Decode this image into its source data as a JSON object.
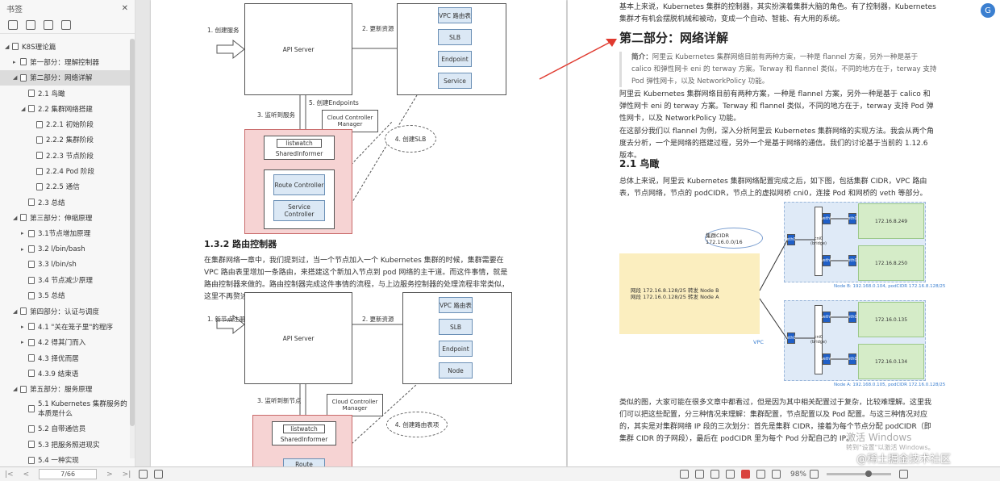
{
  "sidebar": {
    "title": "书签",
    "close": "✕",
    "items": [
      {
        "label": "K8S理论篇",
        "arrow": "◢",
        "indent": 0
      },
      {
        "label": "第一部分：理解控制器",
        "arrow": "▸",
        "indent": 1
      },
      {
        "label": "第二部分：网络详解",
        "arrow": "◢",
        "indent": 1,
        "active": true
      },
      {
        "label": "2.1 鸟瞰",
        "arrow": "",
        "indent": 2
      },
      {
        "label": "2.2 集群网络搭建",
        "arrow": "◢",
        "indent": 2
      },
      {
        "label": "2.2.1 初始阶段",
        "arrow": "",
        "indent": 3
      },
      {
        "label": "2.2.2 集群阶段",
        "arrow": "",
        "indent": 3
      },
      {
        "label": "2.2.3 节点阶段",
        "arrow": "",
        "indent": 3
      },
      {
        "label": "2.2.4 Pod 阶段",
        "arrow": "",
        "indent": 3
      },
      {
        "label": "2.2.5 通信",
        "arrow": "",
        "indent": 3
      },
      {
        "label": "2.3 总结",
        "arrow": "",
        "indent": 2
      },
      {
        "label": "第三部分：伸缩原理",
        "arrow": "◢",
        "indent": 1
      },
      {
        "label": "3.1节点增加原理",
        "arrow": "▸",
        "indent": 2
      },
      {
        "label": "3.2 l/bin/bash",
        "arrow": "▸",
        "indent": 2
      },
      {
        "label": "3.3 l/bin/sh",
        "arrow": "",
        "indent": 2
      },
      {
        "label": "3.4 节点减少原理",
        "arrow": "",
        "indent": 2
      },
      {
        "label": "3.5 总结",
        "arrow": "",
        "indent": 2
      },
      {
        "label": "第四部分：认证与调度",
        "arrow": "◢",
        "indent": 1
      },
      {
        "label": "4.1 \"关在笼子里\"的程序",
        "arrow": "▸",
        "indent": 2
      },
      {
        "label": "4.2 得其门而入",
        "arrow": "▸",
        "indent": 2
      },
      {
        "label": "4.3 择优而居",
        "arrow": "",
        "indent": 2
      },
      {
        "label": "4.3.9 结束语",
        "arrow": "",
        "indent": 2
      },
      {
        "label": "第五部分：服务原理",
        "arrow": "◢",
        "indent": 1
      },
      {
        "label": "5.1 Kubernetes 集群服务的本质是什么",
        "arrow": "",
        "indent": 2,
        "two": true
      },
      {
        "label": "5.2 自带通信员",
        "arrow": "",
        "indent": 2
      },
      {
        "label": "5.3 把服务照进现实",
        "arrow": "",
        "indent": 2
      },
      {
        "label": "5.4 一种实现",
        "arrow": "",
        "indent": 2
      }
    ]
  },
  "diagram1": {
    "create": "1. 创建服务",
    "api": "API Server",
    "update": "2. 更新资源",
    "vpc": "VPC 路由表",
    "slb": "SLB",
    "endpoint": "Endpoint",
    "service": "Service",
    "listen": "3. 监听到服务",
    "createEp": "5. 创建Endpoints",
    "ccm": "Cloud Controller Manager",
    "listwatch": "listwatch",
    "informer": "SharedInformer",
    "route": "Route Controller",
    "svc": "Service Controller",
    "createSlb": "4. 创建SLB"
  },
  "section132": {
    "title": "1.3.2 路由控制器",
    "body": "在集群网络一章中，我们提到过，当一个节点加入一个 Kubernetes 集群的时候，集群需要在 VPC 路由表里增加一条路由，来搭建这个新加入节点到 pod 网络的主干道。而这件事情，就是路由控制器来做的。路由控制器完成这件事情的流程，与上边服务控制器的处理流程非常类似，这里不再赘述。"
  },
  "diagram2": {
    "register": "1. 新节点注册",
    "api": "API Server",
    "update": "2. 更新资源",
    "vpc": "VPC 路由表",
    "slb": "SLB",
    "endpoint": "Endpoint",
    "node": "Node",
    "listen": "3. 监听到新节点",
    "ccm": "Cloud Controller Manager",
    "listwatch": "listwatch",
    "informer": "SharedInformer",
    "route": "Route",
    "createRoute": "4. 创建路由表项"
  },
  "right": {
    "intro": "基本上来说，Kubernetes 集群的控制器，其实扮演着集群大脑的角色。有了控制器，Kubernetes 集群才有机会摆脱机械和被动，变成一个自动、智能、有大用的系统。",
    "part2": "第二部分：网络详解",
    "summaryLabel": "简介：",
    "summary": "阿里云 Kubernetes 集群网络目前有两种方案，一种是 flannel 方案，另外一种是基于 calico 和弹性网卡 eni 的 terway 方案。Terway 和 flannel 类似，不同的地方在于，terway 支持 Pod 弹性网卡，以及 NetworkPolicy 功能。",
    "p1": "阿里云 Kubernetes 集群网络目前有两种方案，一种是 flannel 方案，另外一种是基于 calico 和弹性网卡 eni 的 terway 方案。Terway 和 flannel 类似，不同的地方在于，terway 支持 Pod 弹性网卡，以及 NetworkPolicy 功能。",
    "p2": "在这部分我们以 flannel 为例，深入分析阿里云 Kubernetes 集群网络的实现方法。我会从两个角度去分析，一个是网络的搭建过程，另外一个是基于网络的通信。我们的讨论基于当前的 1.12.6 版本。",
    "h21": "2.1 鸟瞰",
    "p3": "总体上来说，阿里云 Kubernetes 集群网络配置完成之后，如下图，包括集群 CIDR，VPC 路由表，节点网络，节点的 podCIDR，节点上的虚拟网桥 cni0，连接 Pod 和网桥的 veth 等部分。",
    "p4": "类似的图，大家可能在很多文章中都看过，但是因为其中相关配置过于复杂，比较难理解。这里我们可以把这些配置，分三种情况来理解：集群配置，节点配置以及 Pod 配置。与这三种情况对应的，其实是对集群网络 IP 段的三次划分：首先是集群 CIDR，接着为每个节点分配 podCIDR（即集群 CIDR 的子网段），最后在 podCIDR 里为每个 Pod 分配自己的 IP。"
  },
  "net": {
    "cloud": "集群CIDR 172.16.0.0/16",
    "route1": "网段 172.16.8.128/25 转发 Node B",
    "route2": "网段 172.16.0.128/25 转发 Node A",
    "vpc": "VPC",
    "ip1": "172.16.8.249",
    "ip2": "172.16.8.250",
    "ip3": "172.16.0.135",
    "ip4": "172.16.0.134",
    "nodeB": "Node B: 192.168.0.104, podCIDR 172.16.8.128/25",
    "nodeA": "Node A: 192.168.0.105, podCIDR 172.16.0.128/25",
    "cni0": "cni0 (bridge)",
    "eth0": "eth0",
    "veth0": "veth0"
  },
  "status": {
    "page": "7/66",
    "zoom": "98%"
  },
  "watermark": {
    "win": "激活 Windows",
    "winsub": "转到\"设置\"以激活 Windows。",
    "site": "@稀土掘金技术社区"
  }
}
